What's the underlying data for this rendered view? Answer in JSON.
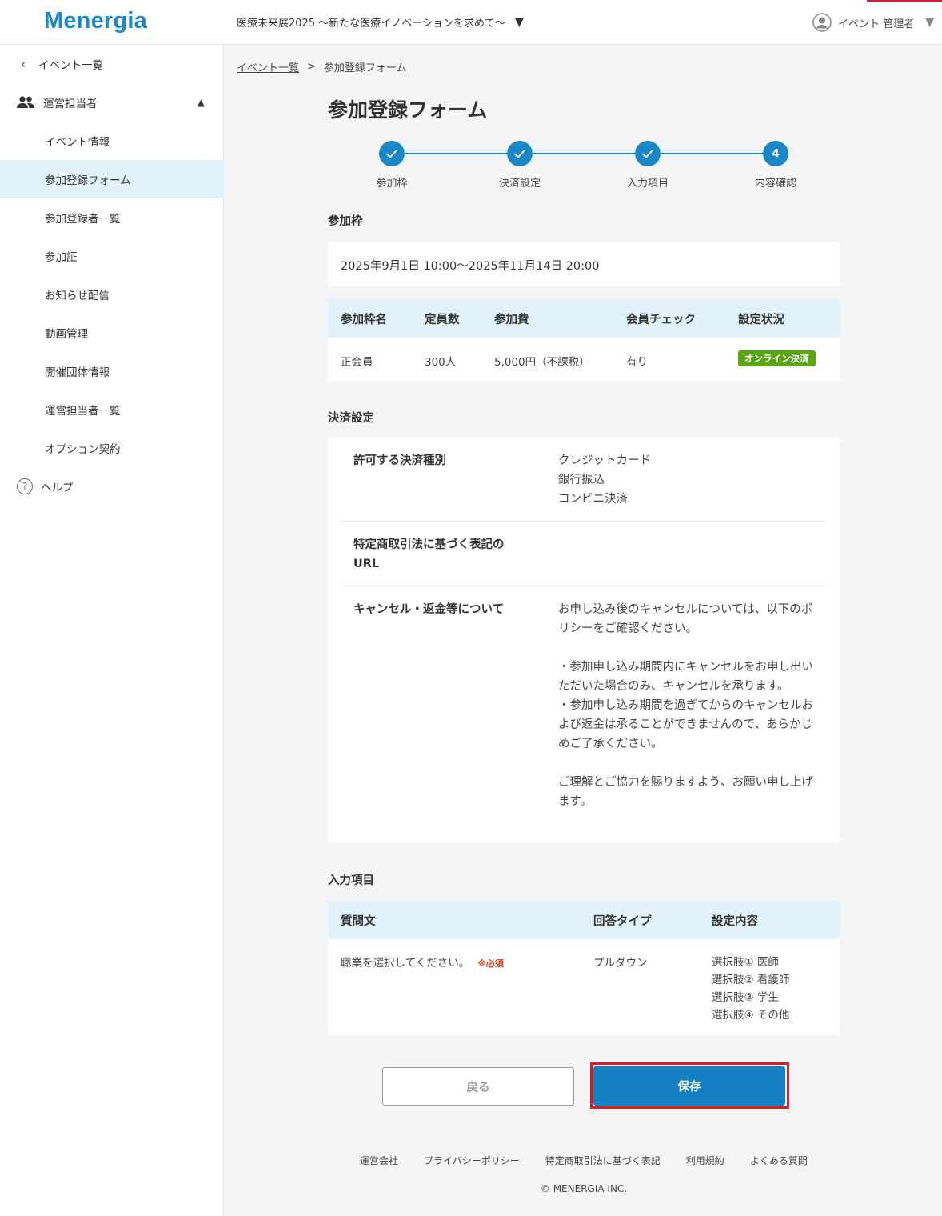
{
  "header": {
    "logo": "Menergia",
    "event_name": "医療未来展2025 〜新たな医療イノベーションを求めて〜",
    "user_name": "イベント 管理者"
  },
  "sidebar": {
    "back": "イベント一覧",
    "group": "運営担当者",
    "items": [
      {
        "label": "イベント情報"
      },
      {
        "label": "参加登録フォーム",
        "active": true
      },
      {
        "label": "参加登録者一覧"
      },
      {
        "label": "参加証"
      },
      {
        "label": "お知らせ配信"
      },
      {
        "label": "動画管理"
      },
      {
        "label": "開催団体情報"
      },
      {
        "label": "運営担当者一覧"
      },
      {
        "label": "オプション契約"
      }
    ],
    "help": "ヘルプ"
  },
  "breadcrumb": {
    "parent": "イベント一覧",
    "separator": ">",
    "current": "参加登録フォーム"
  },
  "page_title": "参加登録フォーム",
  "stepper": {
    "steps": [
      {
        "label": "参加枠",
        "state": "done"
      },
      {
        "label": "決済設定",
        "state": "done"
      },
      {
        "label": "入力項目",
        "state": "done"
      },
      {
        "label": "内容確認",
        "state": "current",
        "number": "4"
      }
    ]
  },
  "slots": {
    "title": "参加枠",
    "period": "2025年9月1日 10:00〜2025年11月14日 20:00",
    "columns": [
      "参加枠名",
      "定員数",
      "参加費",
      "会員チェック",
      "設定状況"
    ],
    "rows": [
      {
        "name": "正会員",
        "capacity": "300人",
        "fee": "5,000円（不課税）",
        "member_check": "有り",
        "status": "オンライン決済"
      }
    ]
  },
  "payment": {
    "title": "決済設定",
    "methods_label": "許可する決済種別",
    "methods": "クレジットカード\n銀行振込\nコンビニ決済",
    "tokusho_label": "特定商取引法に基づく表記の\nURL",
    "tokusho_value": "",
    "cancel_label": "キャンセル・返金等について",
    "cancel_text": "お申し込み後のキャンセルについては、以下のポリシーをご確認ください。\n\n・参加申し込み期間内にキャンセルをお申し出いただいた場合のみ、キャンセルを承ります。\n・参加申し込み期間を過ぎてからのキャンセルおよび返金は承ることができませんので、あらかじめご了承ください。\n\nご理解とご協力を賜りますよう、お願い申し上げます。"
  },
  "inputs": {
    "title": "入力項目",
    "columns": [
      "質問文",
      "回答タイプ",
      "設定内容"
    ],
    "rows": [
      {
        "question": "職業を選択してください。",
        "required": "※必須",
        "type": "プルダウン",
        "options": [
          "選択肢① 医師",
          "選択肢② 看護師",
          "選択肢③ 学生",
          "選択肢④ その他"
        ]
      }
    ]
  },
  "actions": {
    "back": "戻る",
    "save": "保存"
  },
  "footer": {
    "links": [
      "運営会社",
      "プライバシーポリシー",
      "特定商取引法に基づく表記",
      "利用規約",
      "よくある質問"
    ],
    "copyright": "© MENERGIA INC."
  },
  "colors": {
    "accent": "#1a87c7",
    "active_bg": "#e1f2fa",
    "badge": "#5aa418",
    "highlight": "#d21f2d",
    "required": "#d9401f"
  }
}
